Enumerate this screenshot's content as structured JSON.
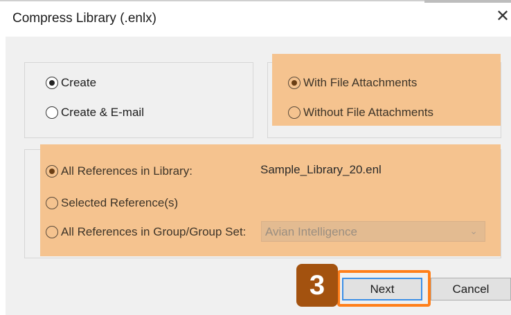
{
  "window": {
    "title": "Compress Library (.enlx)",
    "close_icon": "close-icon"
  },
  "action_group": {
    "options": [
      {
        "label": "Create",
        "selected": true
      },
      {
        "label": "Create & E-mail",
        "selected": false
      }
    ]
  },
  "attachments_group": {
    "options": [
      {
        "label": "With File Attachments",
        "selected": true
      },
      {
        "label": "Without File Attachments",
        "selected": false
      }
    ]
  },
  "references_group": {
    "options": [
      {
        "label": "All References in Library:",
        "selected": true
      },
      {
        "label": "Selected Reference(s)",
        "selected": false
      },
      {
        "label": "All References in Group/Group Set:",
        "selected": false
      }
    ],
    "library_name": "Sample_Library_20.enl",
    "group_select": {
      "value": "Avian Intelligence",
      "icon": "chevron-down-icon"
    }
  },
  "buttons": {
    "next": "Next",
    "cancel": "Cancel"
  },
  "annotation": {
    "step_number": "3",
    "highlight_color": "#f5c38f",
    "badge_color": "#a3520f",
    "outline_color": "#ff7f1a"
  }
}
